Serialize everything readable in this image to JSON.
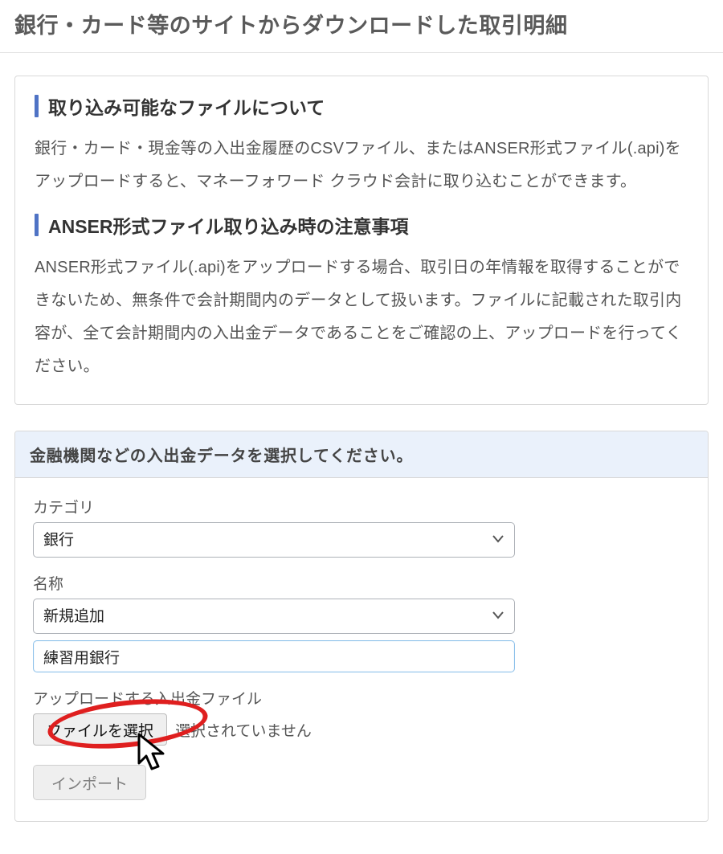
{
  "page_title": "銀行・カード等のサイトからダウンロードした取引明細",
  "info": {
    "section1_title": "取り込み可能なファイルについて",
    "section1_body": "銀行・カード・現金等の入出金履歴のCSVファイル、またはANSER形式ファイル(.api)をアップロードすると、マネーフォワード クラウド会計に取り込むことができます。",
    "section2_title": "ANSER形式ファイル取り込み時の注意事項",
    "section2_body": "ANSER形式ファイル(.api)をアップロードする場合、取引日の年情報を取得することができないため、無条件で会計期間内のデータとして扱います。ファイルに記載された取引内容が、全て会計期間内の入出金データであることをご確認の上、アップロードを行ってください。"
  },
  "form": {
    "header": "金融機関などの入出金データを選択してください。",
    "category_label": "カテゴリ",
    "category_value": "銀行",
    "name_label": "名称",
    "name_value": "新規追加",
    "name_text_value": "練習用銀行",
    "upload_label": "アップロードする入出金ファイル",
    "choose_button": "ファイルを選択",
    "file_status": "選択されていません",
    "import_button": "インポート"
  }
}
